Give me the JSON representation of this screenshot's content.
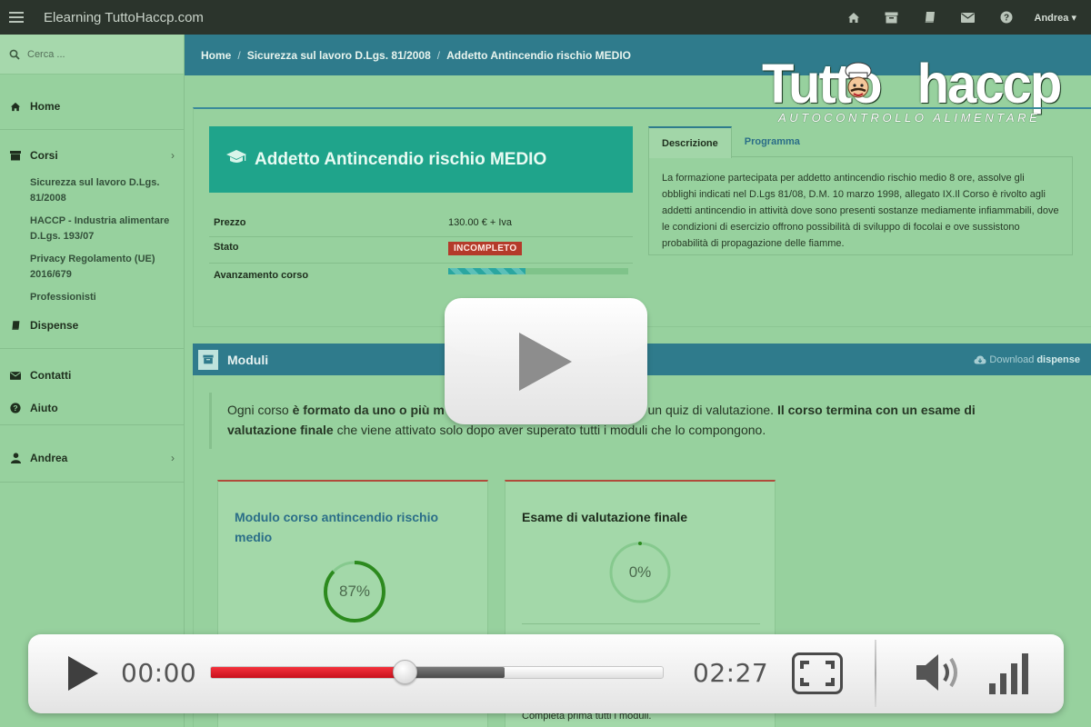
{
  "topbar": {
    "title": "Elearning TuttoHaccp.com",
    "user": "Andrea",
    "icons": [
      "menu-icon",
      "home-icon",
      "archive-icon",
      "book-icon",
      "envelope-icon",
      "question-icon"
    ]
  },
  "sidebar": {
    "search_placeholder": "Cerca ...",
    "items": [
      {
        "label": "Home",
        "icon": "home-icon"
      },
      {
        "label": "Corsi",
        "icon": "folder-icon"
      },
      {
        "label": "Dispense",
        "icon": "book-icon"
      },
      {
        "label": "Contatti",
        "icon": "envelope-icon"
      },
      {
        "label": "Aiuto",
        "icon": "question-icon"
      },
      {
        "label": "Andrea",
        "icon": "user-icon"
      }
    ],
    "courses": [
      "Sicurezza sul lavoro D.Lgs. 81/2008",
      "HACCP - Industria alimentare D.Lgs. 193/07",
      "Privacy Regolamento (UE) 2016/679",
      "Professionisti"
    ]
  },
  "breadcrumb": [
    "Home",
    "Sicurezza sul lavoro D.Lgs. 81/2008",
    "Addetto Antincendio rischio MEDIO"
  ],
  "logo": {
    "wordmark": "Tutto haccp",
    "tagline": "AUTOCONTROLLO ALIMENTARE"
  },
  "course": {
    "title": "Addetto Antincendio rischio MEDIO",
    "price_label": "Prezzo",
    "price": "130.00 € + Iva",
    "status_label": "Stato",
    "status": "INCOMPLETO",
    "progress_label": "Avanzamento corso",
    "progress_fraction": 0.43
  },
  "tabs": {
    "items": [
      "Descrizione",
      "Programma"
    ],
    "active": 0,
    "description": "La formazione partecipata per addetto antincendio rischio medio 8 ore, assolve gli obblighi indicati nel D.Lgs 81/08, D.M. 10 marzo 1998, allegato IX.Il Corso è rivolto agli addetti antincendio in attività dove sono presenti sostanze mediamente infiammabili, dove le condizioni di esercizio offrono possibilità di sviluppo di focolai e ove sussistono probabilità di propagazione delle fiamme."
  },
  "moduli": {
    "title": "Moduli",
    "download_prefix": "Download",
    "download_bold": "dispense",
    "intro": {
      "p1": "Ogni corso ",
      "b1": "è formato da uno o più m",
      "p2": "o un quiz di valutazione. ",
      "b2": "Il corso termina con un esame di valutazione finale",
      "p3": " che viene attivato solo dopo aver superato tutti i moduli che lo compongono."
    },
    "cards": [
      {
        "title": "Modulo corso antincendio rischio medio",
        "percent_text": "87%",
        "percent": 87,
        "color": "#2c8a1e"
      },
      {
        "title": "Esame di valutazione finale",
        "percent_text": "0%",
        "percent": 0,
        "color": "#2c8a1e",
        "note": "Completa prima tutti i moduli."
      }
    ]
  },
  "player": {
    "current_time": "00:00",
    "duration": "02:27",
    "played_fraction": 0.43,
    "buffered_fraction": 0.65,
    "volume_level": 4,
    "volume_max": 4,
    "icons": [
      "play-icon",
      "fullscreen-icon",
      "speaker-icon",
      "signal-bars-icon"
    ]
  }
}
